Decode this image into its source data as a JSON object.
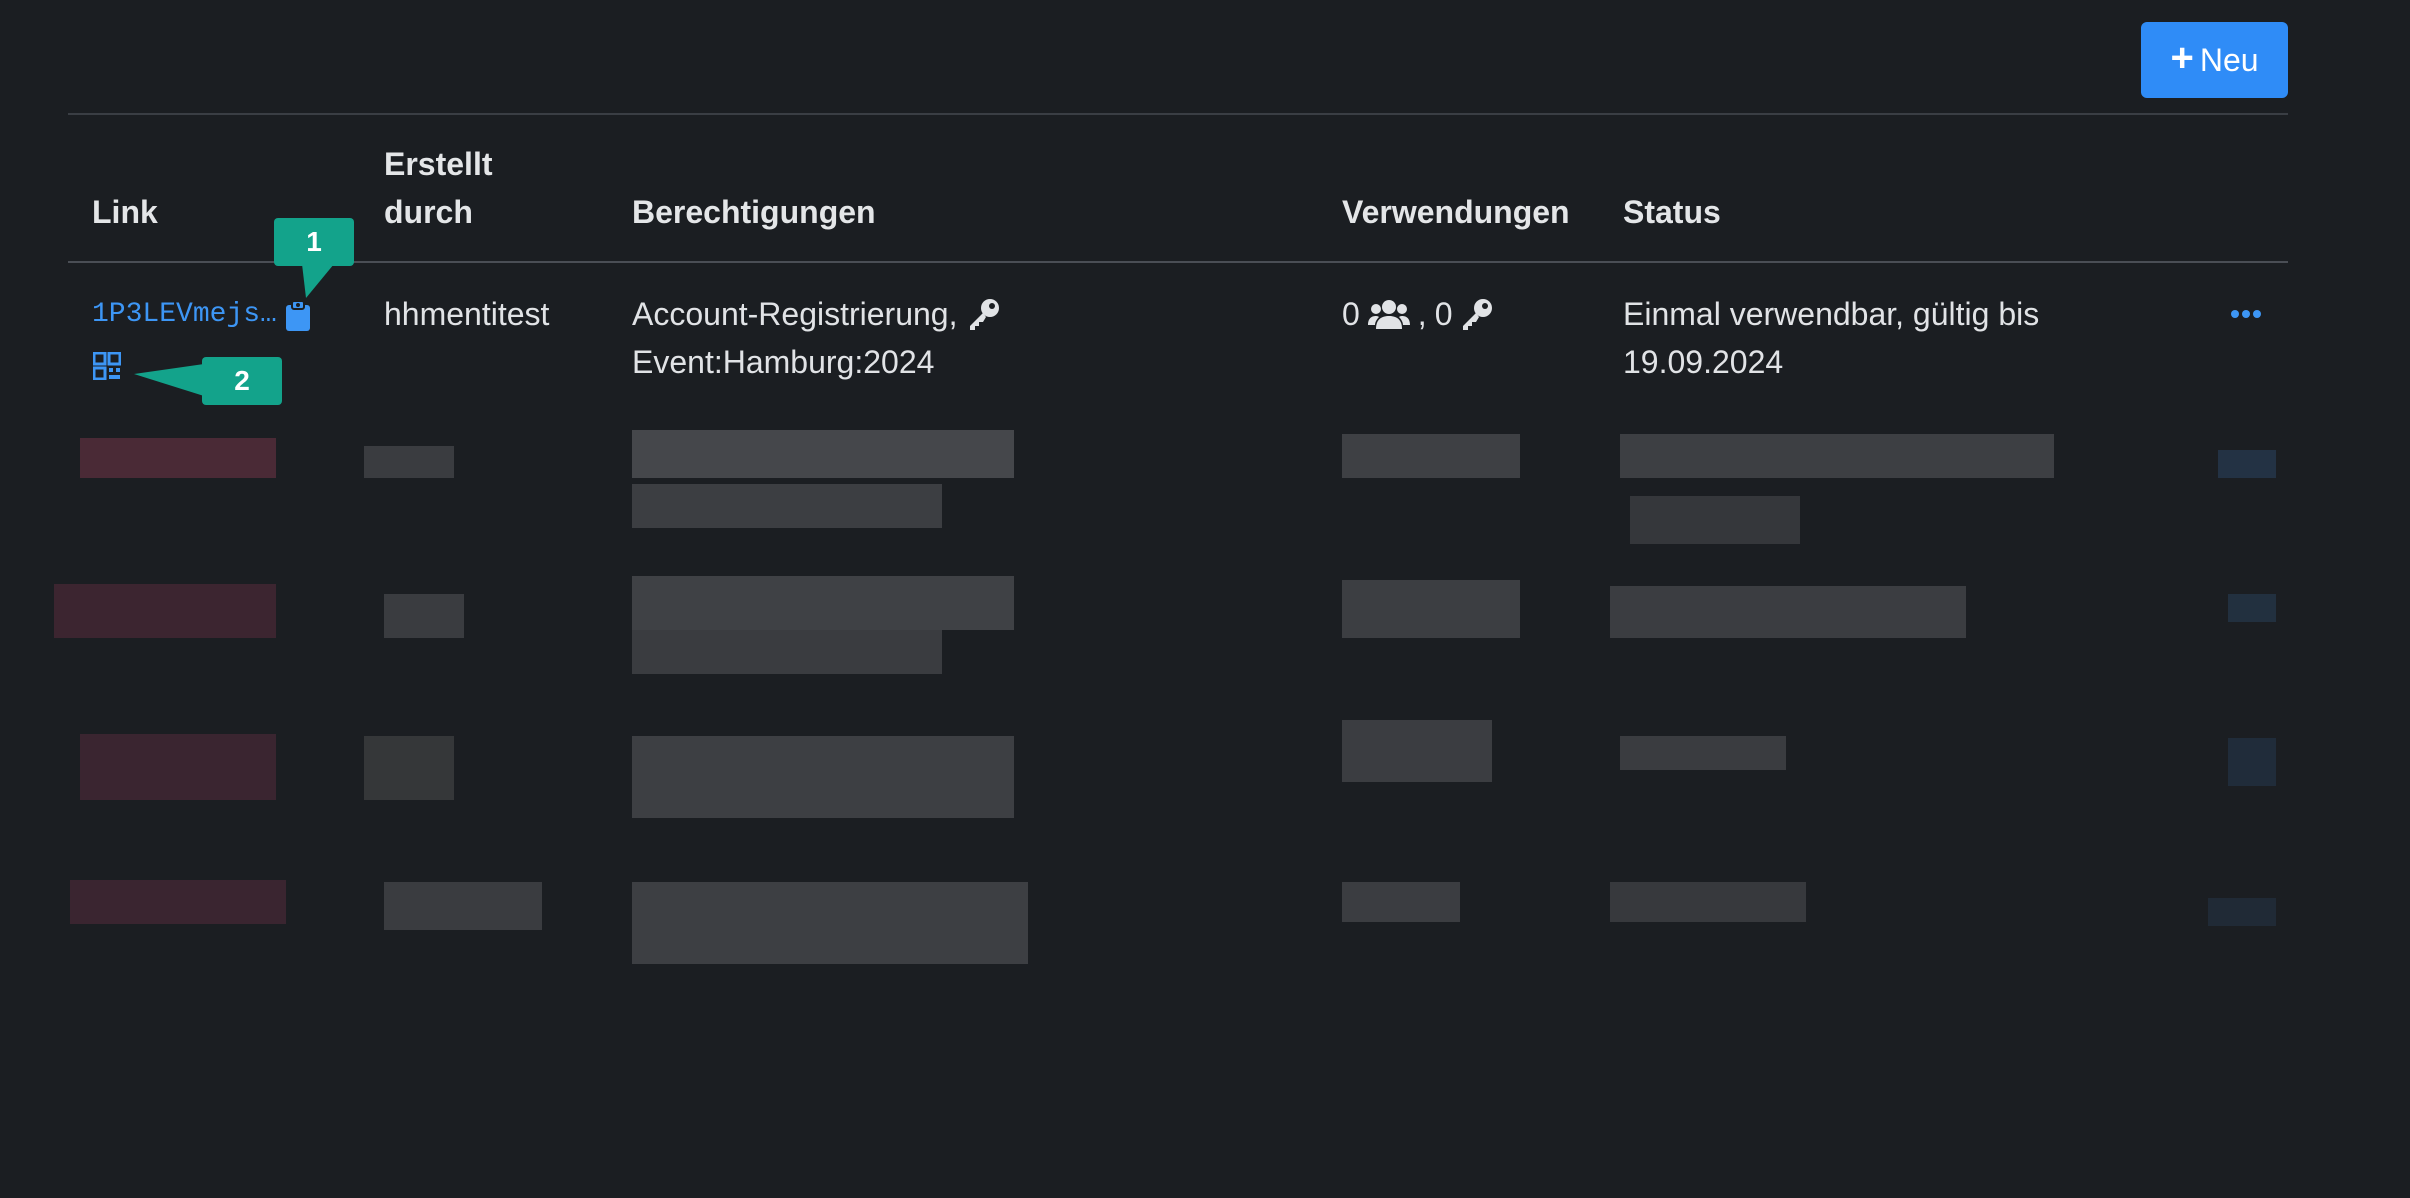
{
  "toolbar": {
    "new_label": "Neu"
  },
  "table": {
    "headers": {
      "link": "Link",
      "created_by_line1": "Erstellt",
      "created_by_line2": "durch",
      "permissions": "Berechtigungen",
      "uses": "Verwendungen",
      "status": "Status"
    },
    "rows": [
      {
        "link": "1P3LEVmejs…",
        "created_by": "hhmentitest",
        "permissions_line1": "Account-Registrierung,",
        "permissions_line2": "Event:Hamburg:2024",
        "uses_users": "0",
        "uses_keys": "0",
        "status_line1": "Einmal verwendbar, gültig bis",
        "status_line2": "19.09.2024"
      }
    ]
  },
  "callouts": {
    "one": "1",
    "two": "2"
  },
  "colors": {
    "background": "#1b1e22",
    "accent": "#2f8cf7",
    "link": "#3d96f5",
    "callout": "#13a38b"
  },
  "icons": [
    "plus-icon",
    "clipboard-icon",
    "qr-code-icon",
    "key-icon",
    "users-icon",
    "more-dots-icon"
  ]
}
